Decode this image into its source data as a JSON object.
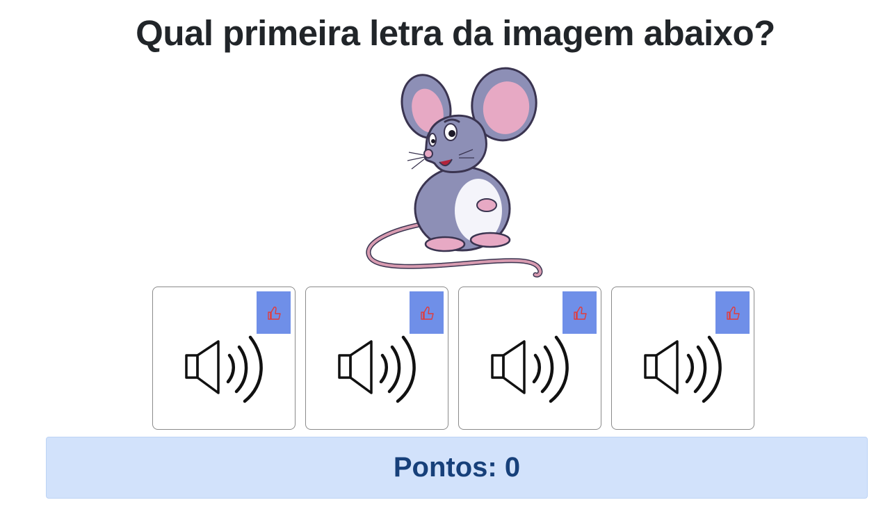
{
  "question": {
    "title": "Qual primeira letra da imagem abaixo?"
  },
  "picture": {
    "subject": "mouse",
    "colors": {
      "body": "#8d8fb6",
      "belly": "#ffffff",
      "ear_inner": "#e7a9c4",
      "tail": "#d89bb0",
      "outline": "#3a3450"
    }
  },
  "options": [
    {
      "icon": "speaker-icon",
      "like_icon": "thumbs-up-icon"
    },
    {
      "icon": "speaker-icon",
      "like_icon": "thumbs-up-icon"
    },
    {
      "icon": "speaker-icon",
      "like_icon": "thumbs-up-icon"
    },
    {
      "icon": "speaker-icon",
      "like_icon": "thumbs-up-icon"
    }
  ],
  "score": {
    "label": "Pontos: 0"
  },
  "colors": {
    "like_button_bg": "#6f8fe8",
    "like_icon": "#e23b3b",
    "score_bg": "#d2e2fb",
    "score_text": "#17407a",
    "title_text": "#212529"
  }
}
